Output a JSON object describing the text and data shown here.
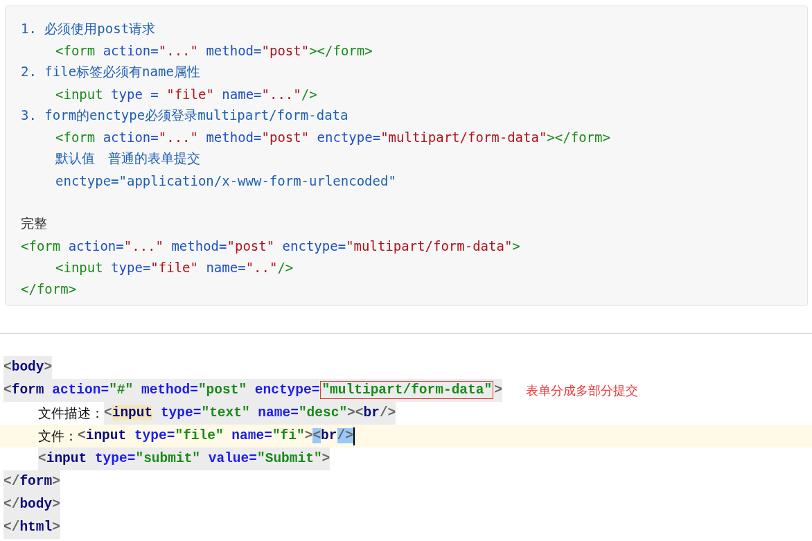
{
  "notes_block": {
    "lines": [
      {
        "kind": "item",
        "text": "1. 必须使用post请求",
        "children": [
          {
            "kind": "code",
            "text": "<form action=\"...\" method=\"post\"></form>"
          }
        ]
      },
      {
        "kind": "item",
        "text": "2. file标签必须有name属性",
        "children": [
          {
            "kind": "code",
            "text": "<input type = \"file\" name=\"...\"/>"
          }
        ]
      },
      {
        "kind": "item",
        "text": "3. form的enctype必须登录multipart/form-data",
        "children": [
          {
            "kind": "code",
            "text": "<form action=\"...\" method=\"post\" enctype=\"multipart/form-data\"></form>"
          },
          {
            "kind": "comment",
            "text": "默认值　普通的表单提交"
          },
          {
            "kind": "comment",
            "text": "enctype=\"application/x-www-form-urlencoded\""
          }
        ]
      },
      {
        "kind": "heading",
        "text": "完整"
      },
      {
        "kind": "code",
        "text": "<form action=\"...\" method=\"post\" enctype=\"multipart/form-data\">",
        "children": [
          {
            "kind": "code",
            "text": "<input type=\"file\" name=\"..\"/>"
          }
        ]
      },
      {
        "kind": "code",
        "text": "</form>"
      }
    ]
  },
  "editor": {
    "lines": [
      {
        "current": false,
        "segments": [
          {
            "text": "<body>",
            "kind": "plain"
          }
        ]
      },
      {
        "current": false,
        "note": "表单分成多部分提交",
        "segments": [
          {
            "text": "<form action=\"#\" method=\"post\" enctype=",
            "kind": "plain"
          },
          {
            "text": "\"multipart/form-data\"",
            "kind": "boxed"
          },
          {
            "text": ">",
            "kind": "plain"
          }
        ],
        "children": [
          {
            "current": false,
            "label": "文件描述：",
            "segments": [
              {
                "text": "<",
                "kind": "plain"
              },
              {
                "text": "input",
                "kind": "matched"
              },
              {
                "text": " type=\"text\" name=\"desc\"><br/>",
                "kind": "plain"
              }
            ]
          },
          {
            "current": true,
            "label": "文件：",
            "segments": [
              {
                "text": "<input type=\"file\" name=\"fi\">",
                "kind": "plain"
              },
              {
                "text": "<",
                "kind": "selected"
              },
              {
                "text": "br",
                "kind": "plain"
              },
              {
                "text": "/>",
                "kind": "selected"
              }
            ]
          },
          {
            "current": false,
            "segments": [
              {
                "text": "<input type=\"submit\" value=\"Submit\">",
                "kind": "plain"
              }
            ]
          }
        ]
      },
      {
        "current": false,
        "segments": [
          {
            "text": "</form>",
            "kind": "plain"
          }
        ]
      },
      {
        "current": false,
        "segments": [
          {
            "text": "</body>",
            "kind": "plain"
          }
        ]
      },
      {
        "current": false,
        "segments": [
          {
            "text": "</html>",
            "kind": "plain"
          }
        ]
      }
    ]
  }
}
